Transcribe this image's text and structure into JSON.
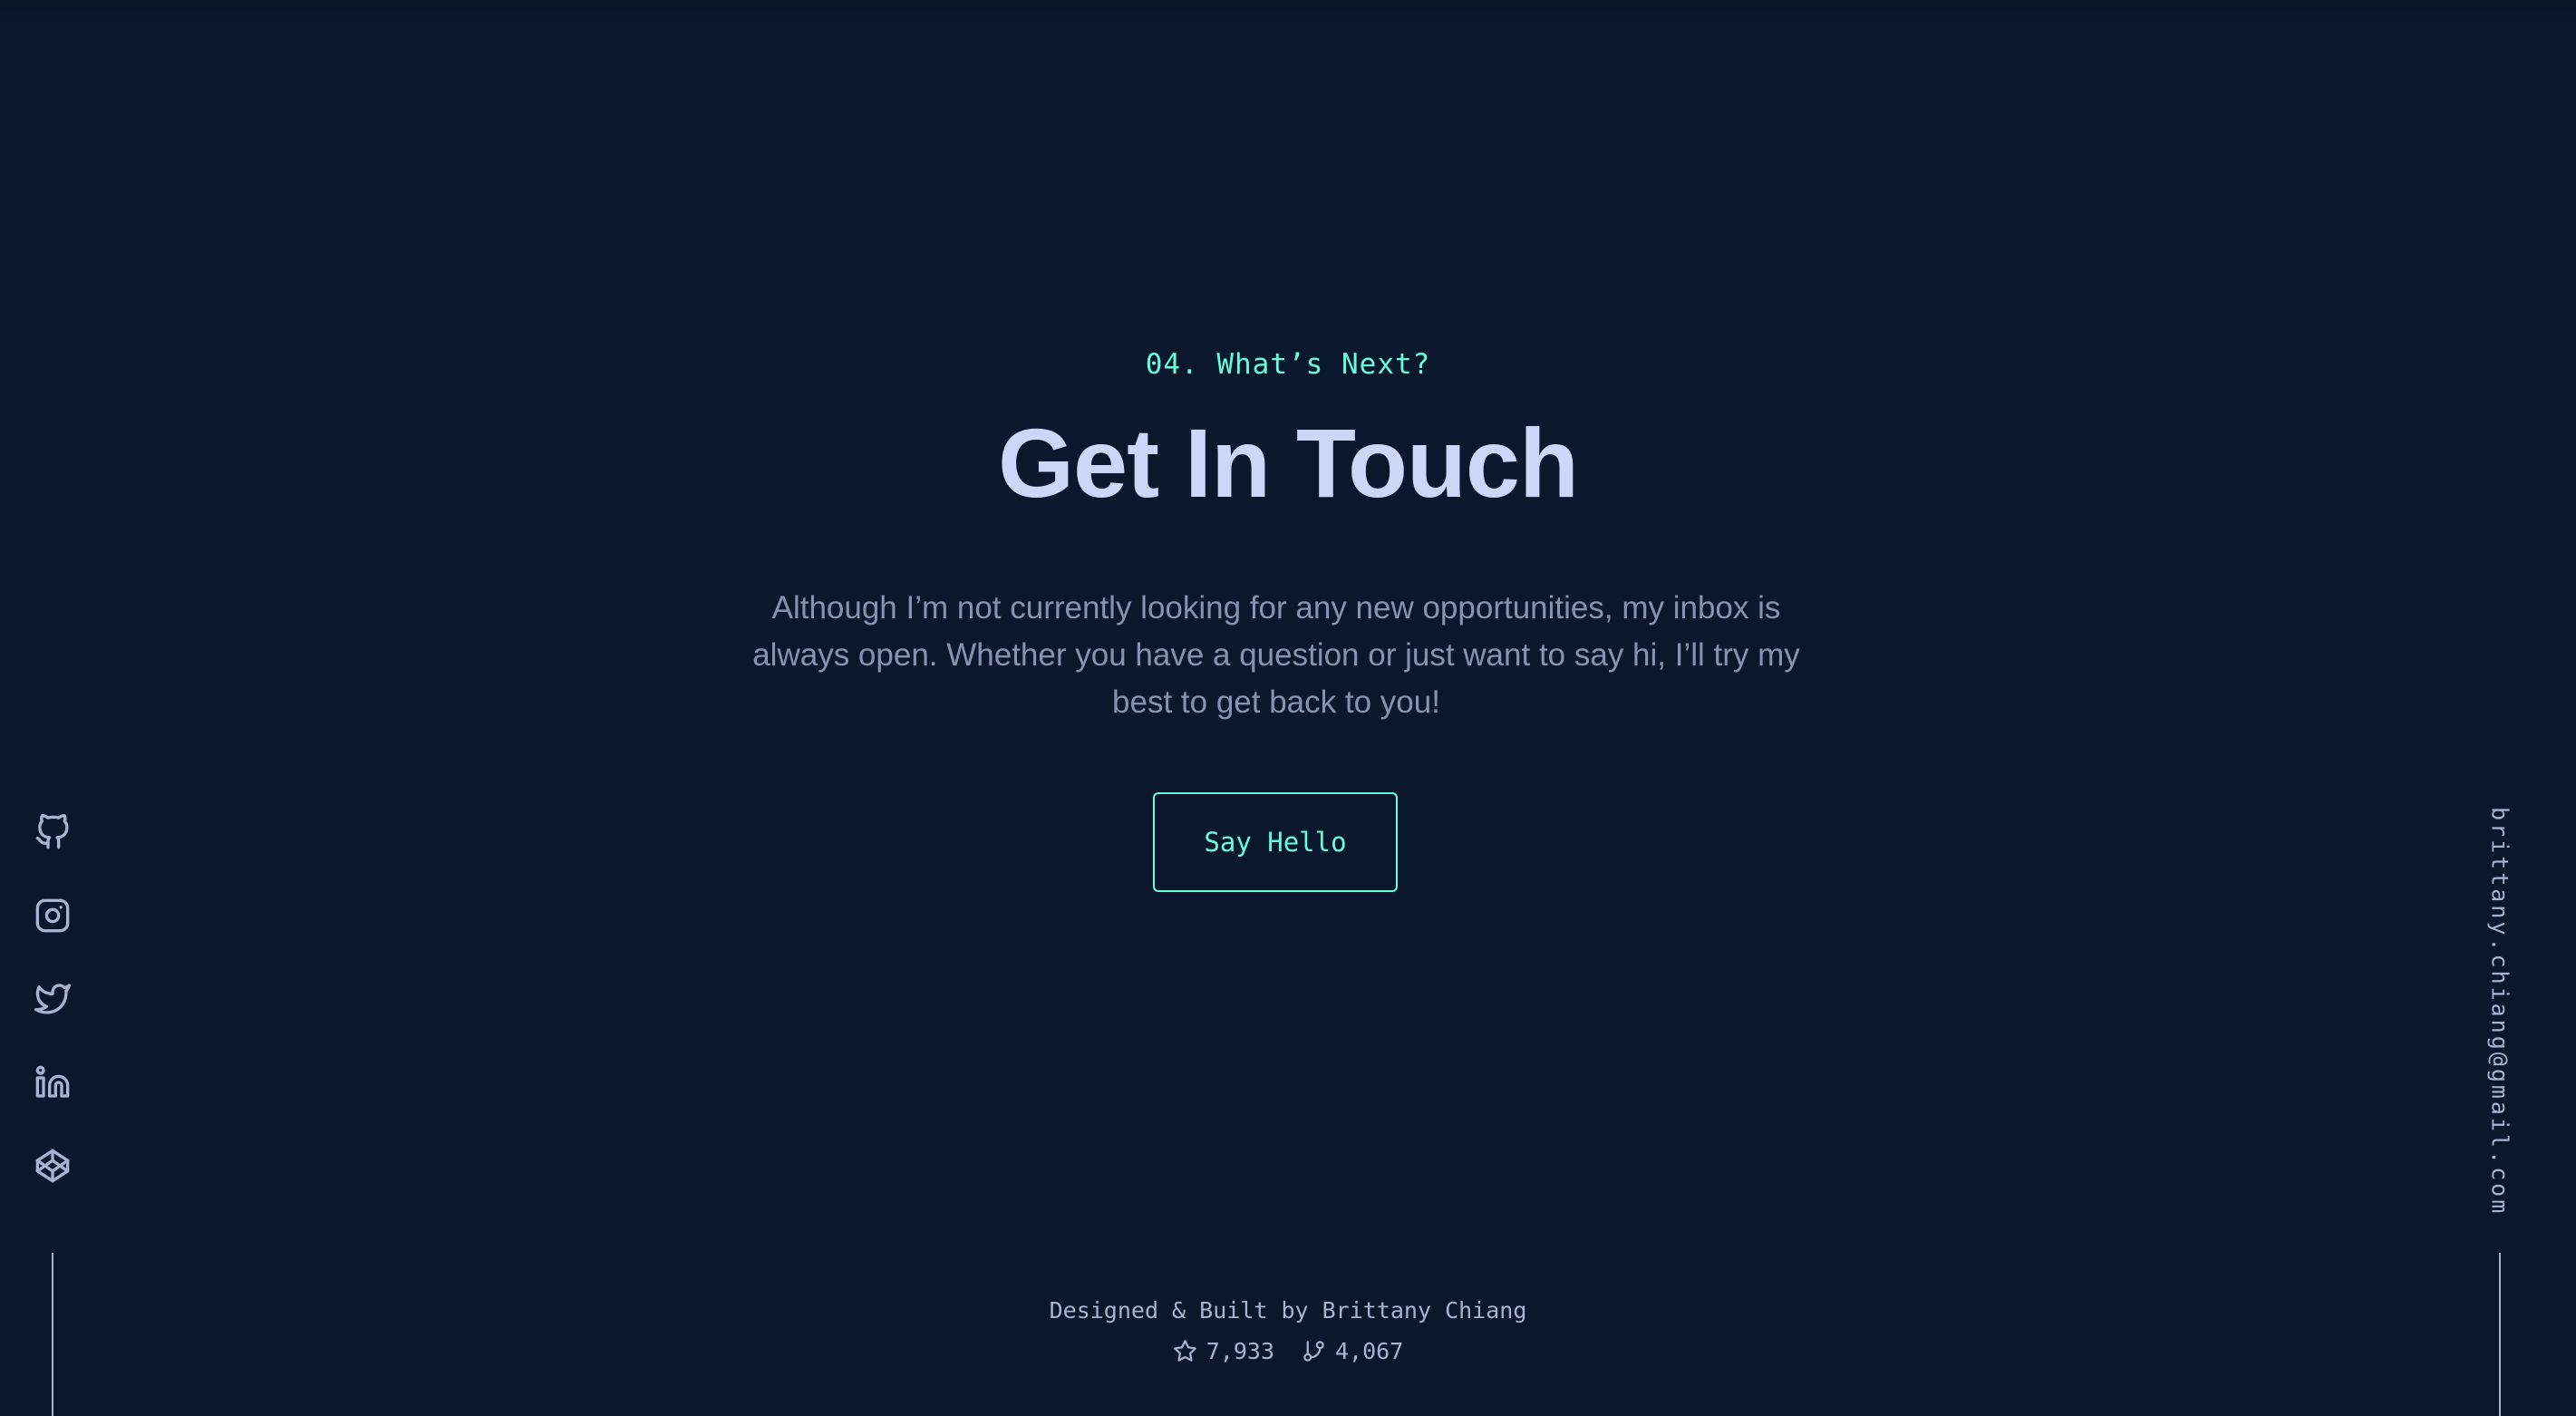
{
  "contact": {
    "overline": "04. What’s Next?",
    "title": "Get In Touch",
    "description": "Although I’m not currently looking for any new opportunities, my inbox is always open. Whether you have a question or just want to say hi, I’ll try my best to get back to you!",
    "button_label": "Say Hello"
  },
  "social": {
    "links": [
      {
        "icon": "github-icon"
      },
      {
        "icon": "instagram-icon"
      },
      {
        "icon": "twitter-icon"
      },
      {
        "icon": "linkedin-icon"
      },
      {
        "icon": "codepen-icon"
      }
    ]
  },
  "email": {
    "address": "brittany.chiang@gmail.com"
  },
  "footer": {
    "credit": "Designed & Built by Brittany Chiang",
    "stars": "7,933",
    "forks": "4,067",
    "star_icon": "star-icon",
    "fork_icon": "fork-icon"
  },
  "colors": {
    "background": "#0b172d",
    "accent": "#64ffda",
    "heading": "#ccd6f6",
    "body_text": "#8892b0",
    "muted": "#a8b2d1"
  }
}
